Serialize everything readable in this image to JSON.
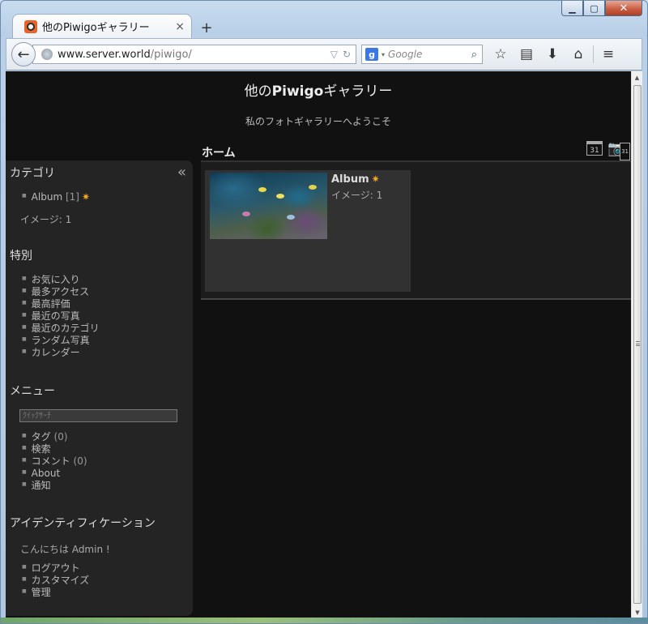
{
  "window": {
    "tab_title": "他のPiwigoギャラリー",
    "tab_close": "×",
    "new_tab": "+",
    "minimize": "▁",
    "maximize": "▢",
    "close": "✕"
  },
  "navbar": {
    "back": "←",
    "url_host": "www.server.world",
    "url_path": "/piwigo/",
    "url_dropdown": "▽",
    "reload": "↻",
    "search_engine": "g",
    "search_caret": "▾",
    "search_placeholder": "Google",
    "search_icon": "⌕",
    "icons": {
      "bookmark": "☆",
      "reader": "▤",
      "download": "⬇",
      "home": "⌂",
      "menu": "≡"
    }
  },
  "page": {
    "title_prefix": "他の",
    "title_bold": "Piwigo",
    "title_suffix": "ギャラリー",
    "subtitle": "私のフォトギャラリーへようこそ",
    "content_title": "ホーム",
    "calendar_label": "31",
    "camera_label": "31"
  },
  "sidebar": {
    "collapse": "«",
    "categories": {
      "heading": "カテゴリ",
      "items": [
        {
          "label": "Album",
          "count": "[1]"
        }
      ],
      "image_count": "イメージ: 1"
    },
    "special": {
      "heading": "特別",
      "items": [
        "お気に入り",
        "最多アクセス",
        "最高評価",
        "最近の写真",
        "最近のカテゴリ",
        "ランダム写真",
        "カレンダー"
      ]
    },
    "menu": {
      "heading": "メニュー",
      "quicksearch_placeholder": "ｸｲｯｸｻｰﾁ",
      "items": [
        {
          "label": "タグ",
          "count": "(0)"
        },
        {
          "label": "検索",
          "count": ""
        },
        {
          "label": "コメント",
          "count": "(0)"
        },
        {
          "label": "About",
          "count": ""
        },
        {
          "label": "通知",
          "count": ""
        }
      ]
    },
    "identification": {
      "heading": "アイデンティフィケーション",
      "greeting": "こんにちは Admin !",
      "items": [
        "ログアウト",
        "カスタマイズ",
        "管理"
      ]
    }
  },
  "albums": [
    {
      "name": "Album",
      "count": "イメージ: 1"
    }
  ],
  "colors": {
    "page_bg": "#111111",
    "sidebar_bg": "#242424",
    "card_bg": "#313131",
    "new_badge": "#f5a623"
  }
}
